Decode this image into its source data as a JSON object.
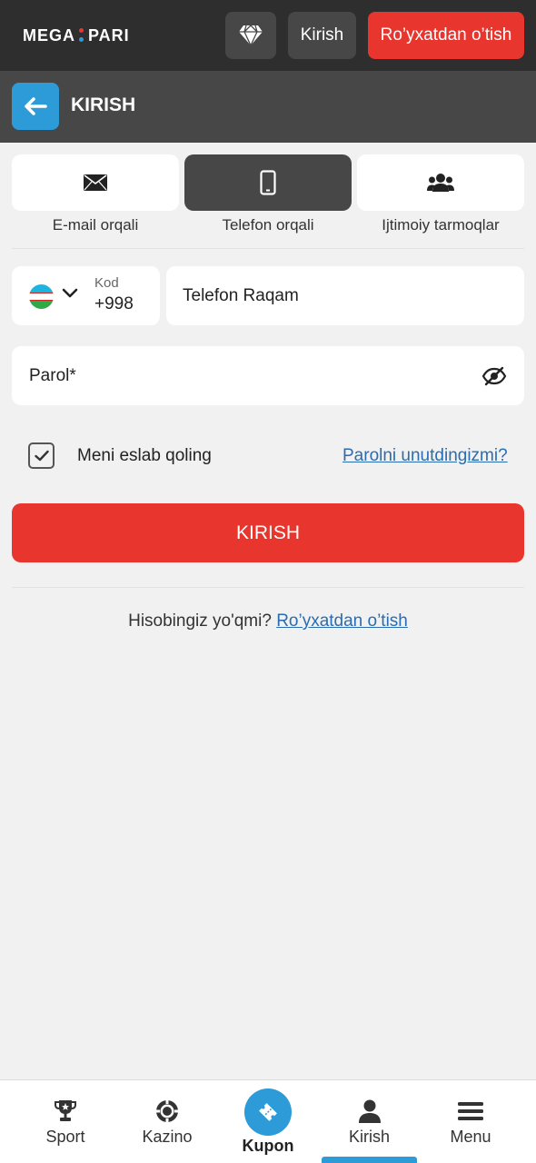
{
  "header": {
    "logo_left": "MEGA",
    "logo_right": "PARI",
    "login_label": "Kirish",
    "register_label": "Ro’yxatdan o’tish",
    "diamond_icon": "diamond-icon"
  },
  "subheader": {
    "title": "KIRISH",
    "back_icon": "arrow-left-icon"
  },
  "login_methods": [
    {
      "label": "E-mail orqali",
      "icon": "envelope-icon",
      "active": false
    },
    {
      "label": "Telefon orqali",
      "icon": "smartphone-icon",
      "active": true
    },
    {
      "label": "Ijtimoiy tarmoqlar",
      "icon": "users-icon",
      "active": false
    }
  ],
  "form": {
    "code_label": "Kod",
    "code_value": "+998",
    "country_flag": "uzbekistan-flag",
    "phone_placeholder": "Telefon Raqam",
    "password_placeholder": "Parol*",
    "remember_label": "Meni eslab qoling",
    "remember_checked": true,
    "forgot_link": "Parolni unutdingizmi?",
    "submit_label": "KIRISH"
  },
  "footer": {
    "question": "Hisobingiz yo'qmi?",
    "register_link": "Ro’yxatdan o’tish"
  },
  "bottom_nav": [
    {
      "label": "Sport",
      "icon": "trophy-icon",
      "active": false
    },
    {
      "label": "Kazino",
      "icon": "casino-chip-icon",
      "active": false
    },
    {
      "label": "Kupon",
      "icon": "ticket-icon",
      "active": false
    },
    {
      "label": "Kirish",
      "icon": "user-icon",
      "active": true
    },
    {
      "label": "Menu",
      "icon": "hamburger-icon",
      "active": false
    }
  ],
  "colors": {
    "top_bar": "#2e2e2e",
    "sub_bar": "#474747",
    "accent_red": "#e8352e",
    "accent_blue": "#2d9bd8",
    "link": "#2b6cb0",
    "background": "#f1f1f1"
  }
}
